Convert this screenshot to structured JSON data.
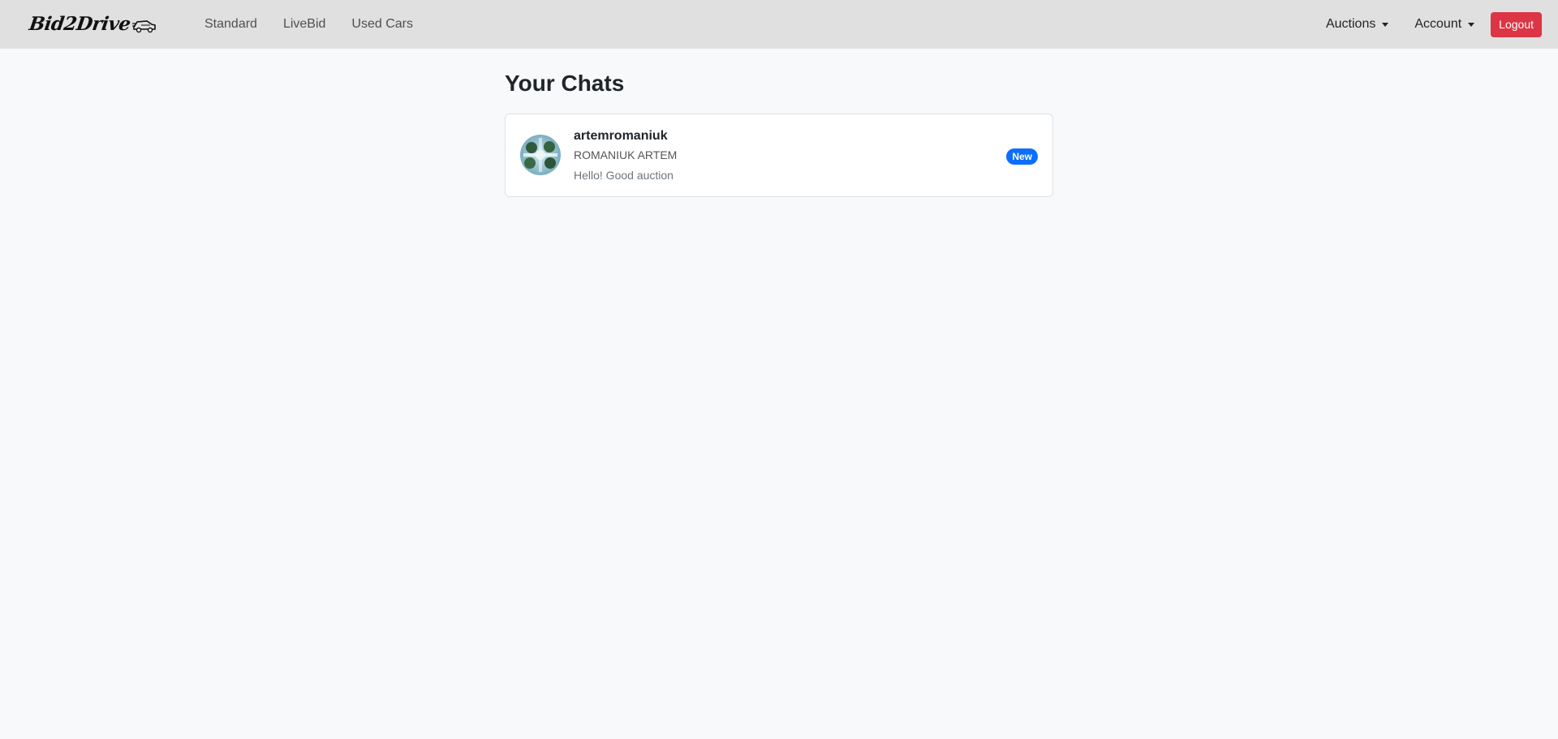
{
  "navbar": {
    "brand_text": "Bid2Drive",
    "links": [
      {
        "label": "Standard"
      },
      {
        "label": "LiveBid"
      },
      {
        "label": "Used Cars"
      }
    ],
    "auctions_label": "Auctions",
    "account_label": "Account",
    "logout_label": "Logout"
  },
  "page": {
    "title": "Your Chats"
  },
  "chats": [
    {
      "username": "artemromaniuk",
      "full_name": "ROMANIUK ARTEM",
      "last_message": "Hello! Good auction",
      "badge": "New"
    }
  ],
  "colors": {
    "navbar_bg": "#e0e0e0",
    "page_bg": "#f8f9fa",
    "logout_bg": "#dc3545",
    "badge_bg": "#0d6efd"
  }
}
